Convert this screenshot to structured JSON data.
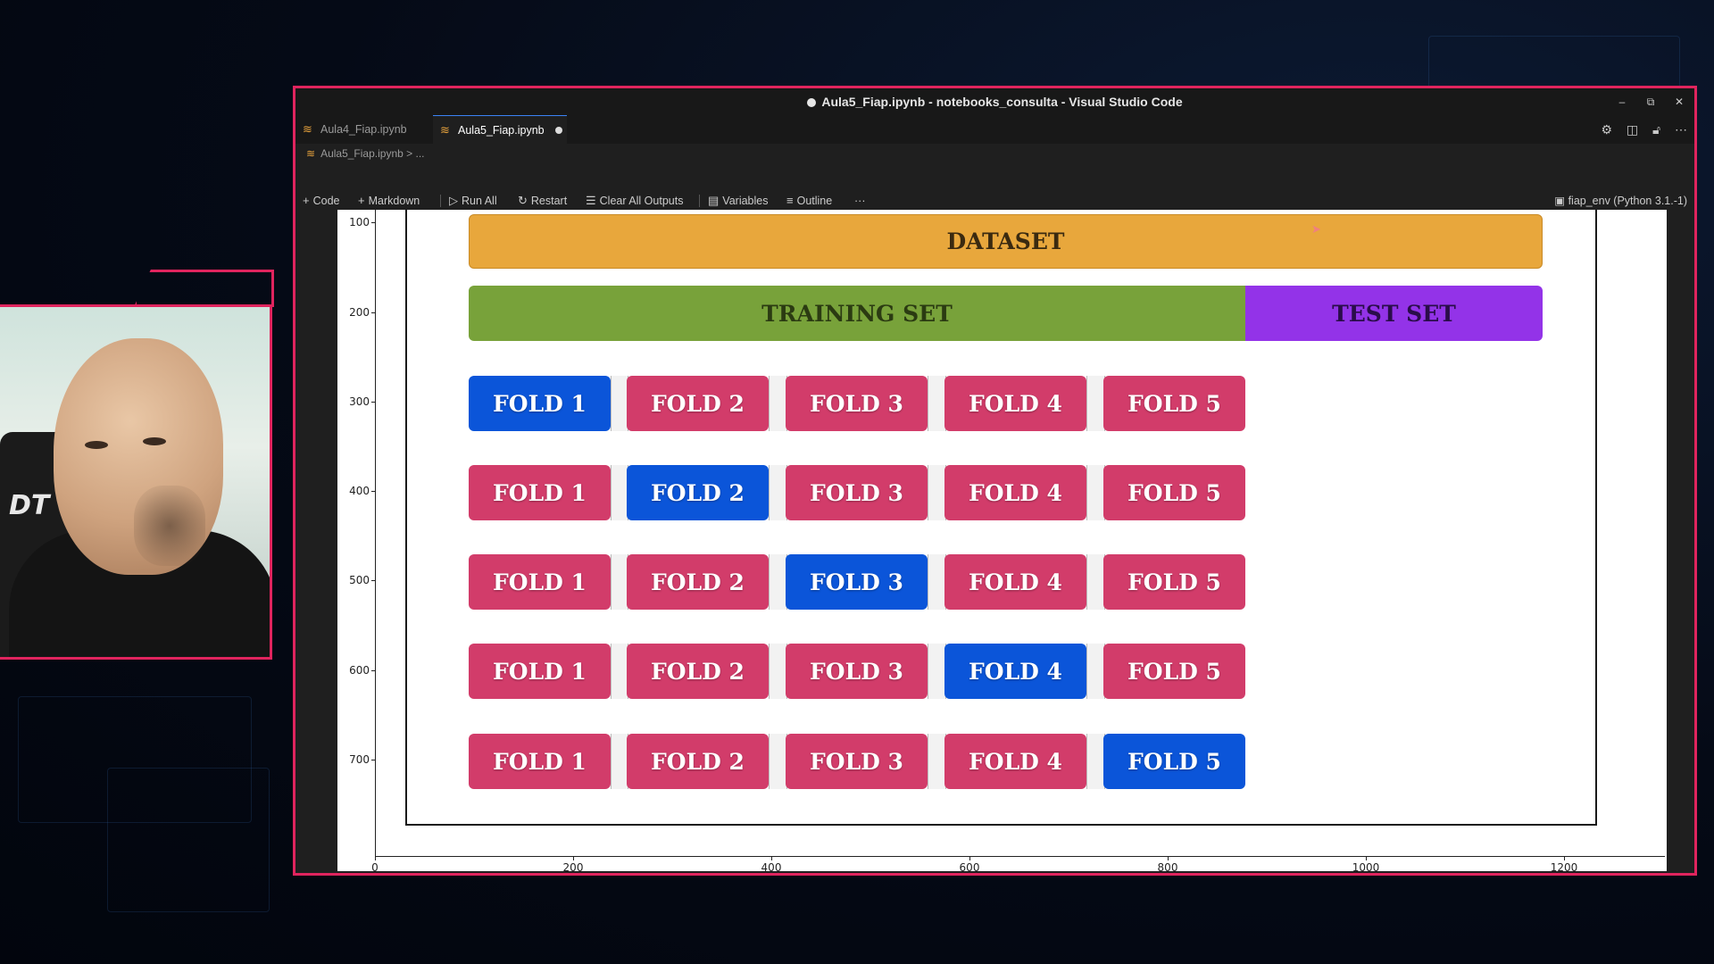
{
  "window": {
    "title": "Aula5_Fiap.ipynb - notebooks_consulta - Visual Studio Code",
    "controls": [
      "–",
      "⧉",
      "✕"
    ]
  },
  "tabs": [
    {
      "label": "Aula4_Fiap.ipynb",
      "active": false
    },
    {
      "label": "Aula5_Fiap.ipynb",
      "active": true,
      "modified": true
    }
  ],
  "breadcrumb": {
    "file": "Aula5_Fiap.ipynb",
    "rest": "> ..."
  },
  "toolbar": {
    "code": "Code",
    "markdown": "Markdown",
    "run_all": "Run All",
    "restart": "Restart",
    "clear_outputs": "Clear All Outputs",
    "variables": "Variables",
    "outline": "Outline",
    "more": "···",
    "kernel": "fiap_env (Python 3.1.-1)"
  },
  "plot": {
    "yticks": [
      "100",
      "200",
      "300",
      "400",
      "500",
      "600",
      "700"
    ],
    "xticks": [
      "0",
      "200",
      "400",
      "600",
      "800",
      "1000",
      "1200"
    ],
    "dataset_label": "DATASET",
    "training_label": "TRAINING SET",
    "test_label": "TEST SET",
    "fold_labels": [
      "FOLD 1",
      "FOLD 2",
      "FOLD 3",
      "FOLD 4",
      "FOLD 5"
    ],
    "test_fold_by_row": [
      1,
      2,
      3,
      4,
      5
    ],
    "colors": {
      "dataset": "#e8a73c",
      "training": "#78a23a",
      "test": "#9333e8",
      "fold_train": "#d23c6a",
      "fold_test": "#0b55d9"
    }
  },
  "webcam": {
    "chair_logo": "DT"
  },
  "accent": "#e0245e"
}
